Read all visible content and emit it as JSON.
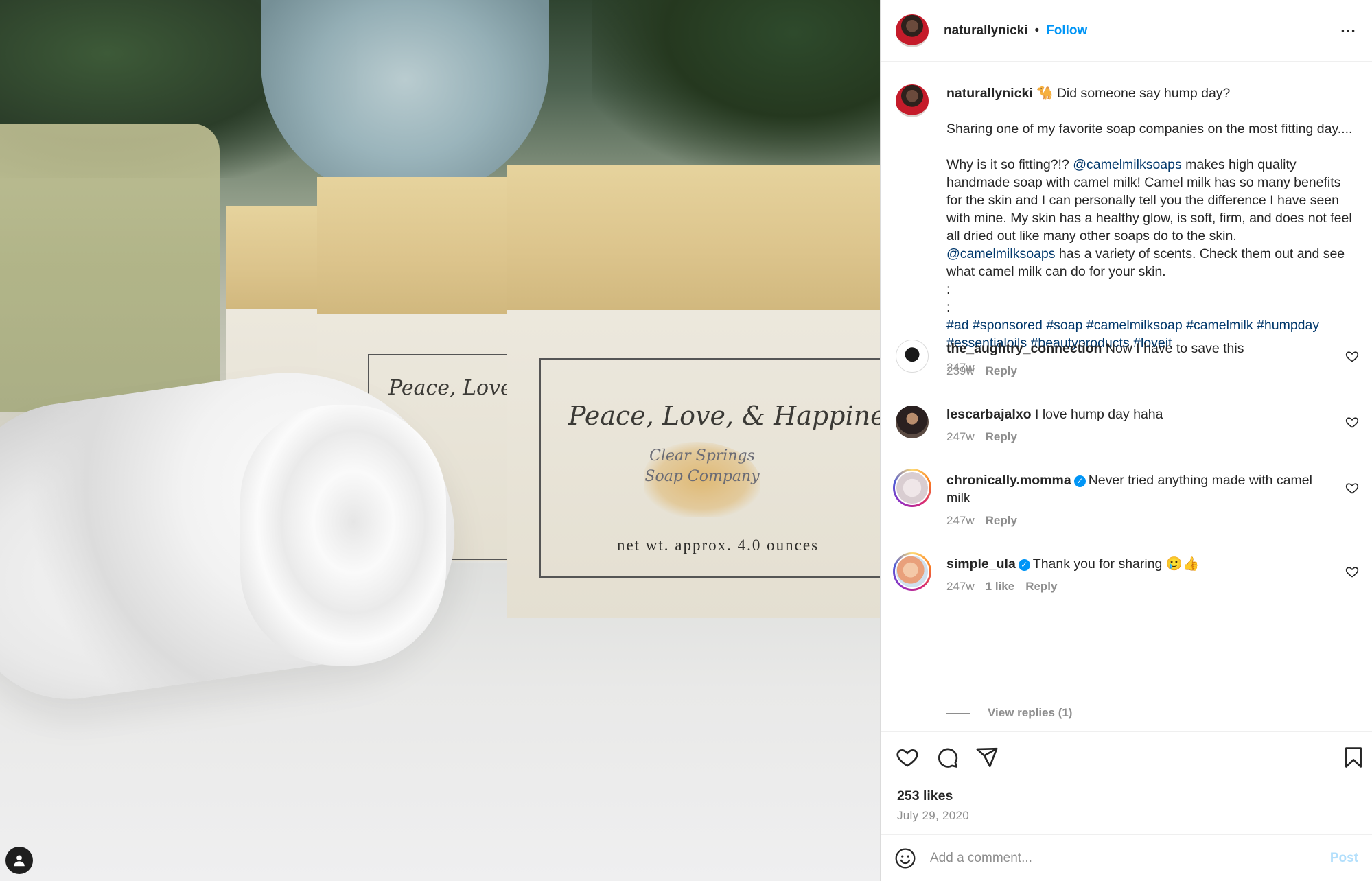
{
  "post": {
    "author": "naturallynicki",
    "follow_label": "Follow",
    "separator": "•",
    "media": {
      "label_title": "Peace, Love, & Happiness",
      "label_title_partial": "Peace, Love,",
      "brand_line1": "Clear Springs",
      "brand_line2": "Soap Company",
      "net_weight": "net wt. approx. 4.0 ounces"
    },
    "caption": {
      "username": "naturallynicki",
      "line1": "🐪 Did someone say hump day?",
      "para2": "Sharing one of my favorite soap companies on the most fitting day....",
      "para3_before": "Why is it so fitting?!? ",
      "para3_mention": "@camelmilksoaps",
      "para3_after": " makes high quality handmade soap with camel milk! Camel milk has so many benefits for the skin and I can personally tell you the difference I have seen with mine. My skin has a healthy glow, is soft, firm, and does not feel all dried out like many other soaps do to the skin.",
      "para4_mention": "@camelmilksoaps",
      "para4_after": " has a variety of scents. Check them out and see what camel milk can do for your skin.",
      "colon1": ":",
      "colon2": ":",
      "hashtags": [
        "#ad",
        "#sponsored",
        "#soap",
        "#camelmilksoap",
        "#camelmilk",
        "#humpday",
        "#essentialoils",
        "#beautyproducts",
        "#loveit"
      ],
      "time": "247w"
    },
    "comments": [
      {
        "username": "the_aughtry_connection",
        "verified": false,
        "text": "Now I have to save this",
        "time": "239w",
        "likes": "",
        "reply": "Reply"
      },
      {
        "username": "lescarbajalxo",
        "verified": false,
        "text": "I love hump day haha",
        "time": "247w",
        "likes": "",
        "reply": "Reply"
      },
      {
        "username": "chronically.momma",
        "verified": true,
        "text": "Never tried anything made with camel milk",
        "time": "247w",
        "likes": "",
        "reply": "Reply"
      },
      {
        "username": "simple_ula",
        "verified": true,
        "text": "Thank you for sharing 🥲👍",
        "time": "247w",
        "likes": "1 like",
        "reply": "Reply"
      }
    ],
    "view_replies": "View replies (1)",
    "likes_count": "253 likes",
    "date": "July 29, 2020",
    "add_comment_placeholder": "Add a comment...",
    "post_label": "Post",
    "verified_mark": "✓"
  },
  "icons": [
    "more-icon",
    "heart-icon",
    "comment-icon",
    "share-icon",
    "save-icon",
    "emoji-icon",
    "user-tag-icon"
  ],
  "colors": {
    "link": "#0095f6",
    "mention": "#00376b",
    "muted": "#8e8e8e",
    "text": "#262626"
  }
}
